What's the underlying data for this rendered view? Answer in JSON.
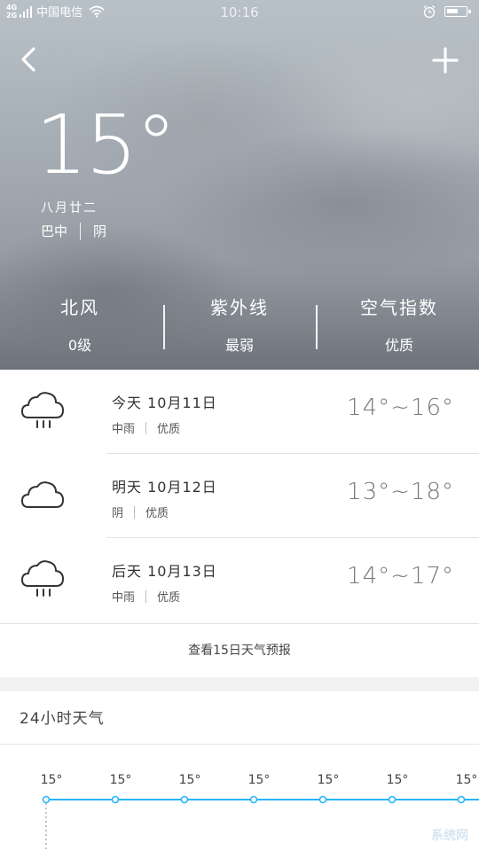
{
  "status_bar": {
    "net_type_top": "4G",
    "net_type_bottom": "2G",
    "carrier": "中国电信",
    "time": "10:16"
  },
  "current": {
    "temp": "15°",
    "lunar_date": "八月廿二",
    "location": "巴中",
    "condition": "阴"
  },
  "indices": [
    {
      "name": "北风",
      "value": "0级"
    },
    {
      "name": "紫外线",
      "value": "最弱"
    },
    {
      "name": "空气指数",
      "value": "优质"
    }
  ],
  "forecast": [
    {
      "day": "今天 10月11日",
      "weather": "中雨",
      "air": "优质",
      "range": "14°~16°",
      "icon": "rain-cloud-icon"
    },
    {
      "day": "明天 10月12日",
      "weather": "阴",
      "air": "优质",
      "range": "13°~18°",
      "icon": "cloud-icon"
    },
    {
      "day": "后天 10月13日",
      "weather": "中雨",
      "air": "优质",
      "range": "14°~17°",
      "icon": "rain-cloud-icon"
    }
  ],
  "more_link": "查看15日天气预报",
  "hourly": {
    "title": "24小时天气",
    "temps": [
      "15°",
      "15°",
      "15°",
      "15°",
      "15°",
      "15°",
      "15°"
    ]
  },
  "colors": {
    "accent": "#29b6f6",
    "hero_bottom": "#6d737a"
  }
}
